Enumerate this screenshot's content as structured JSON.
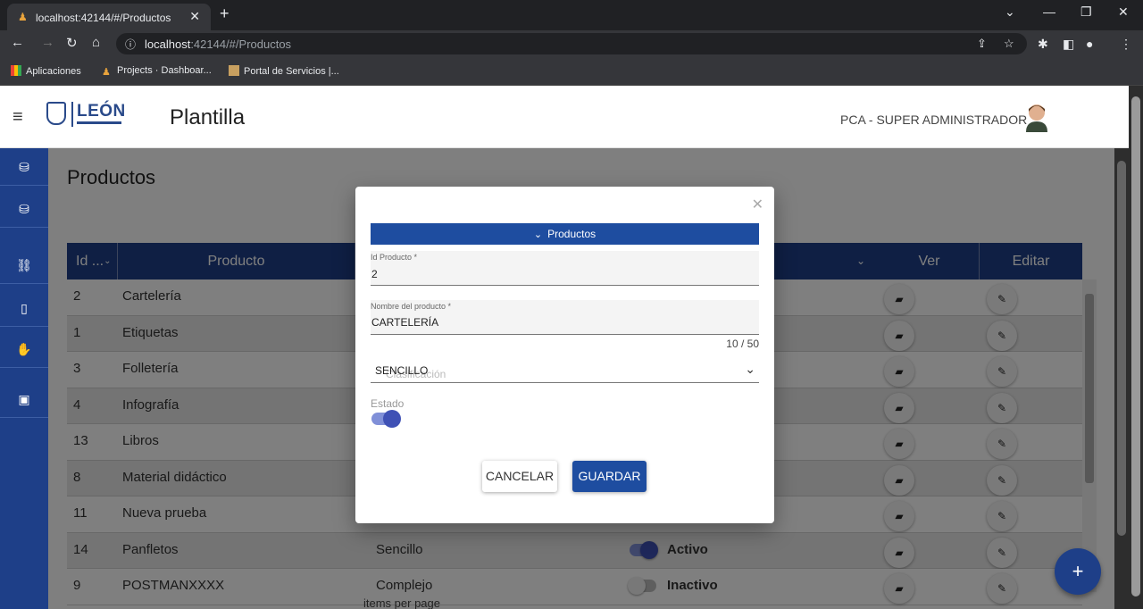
{
  "browser": {
    "tab_title": "localhost:42144/#/Productos",
    "url_host": "localhost",
    "url_rest": ":42144/#/Productos",
    "bookmarks": [
      "Aplicaciones",
      "Projects · Dashboar...",
      "Portal de Servicios |..."
    ]
  },
  "header": {
    "logo_text": "LEÓN",
    "app_title": "Plantilla",
    "user_label": "PCA - SUPER ADMINISTRADOR"
  },
  "sidebar": {
    "items": [
      {
        "icon": "database-icon"
      },
      {
        "icon": "database-icon"
      },
      {
        "icon": "sitemap-icon"
      },
      {
        "icon": "file-icon"
      },
      {
        "icon": "handshake-icon"
      },
      {
        "icon": "image-icon"
      }
    ]
  },
  "page": {
    "title": "Productos"
  },
  "table": {
    "columns": [
      "Id ...",
      "Producto",
      "Ver",
      "Editar"
    ],
    "rows": [
      {
        "id": "2",
        "producto": "Cartelería",
        "clasificacion": "",
        "estado": "",
        "active": null
      },
      {
        "id": "1",
        "producto": "Etiquetas",
        "clasificacion": "",
        "estado": "",
        "active": null
      },
      {
        "id": "3",
        "producto": "Folletería",
        "clasificacion": "",
        "estado": "",
        "active": null
      },
      {
        "id": "4",
        "producto": "Infografía",
        "clasificacion": "",
        "estado": "",
        "active": null
      },
      {
        "id": "13",
        "producto": "Libros",
        "clasificacion": "",
        "estado": "",
        "active": null
      },
      {
        "id": "8",
        "producto": "Material didáctico",
        "clasificacion": "",
        "estado": "",
        "active": null
      },
      {
        "id": "11",
        "producto": "Nueva prueba",
        "clasificacion": "",
        "estado": "",
        "active": null
      },
      {
        "id": "14",
        "producto": "Panfletos",
        "clasificacion": "Sencillo",
        "estado": "Activo",
        "active": true
      },
      {
        "id": "9",
        "producto": "POSTMANXXXX",
        "clasificacion": "Complejo",
        "estado": "Inactivo",
        "active": false
      }
    ]
  },
  "paginator": {
    "label": "items per page"
  },
  "dialog": {
    "header": "Productos",
    "id_label": "Id Producto *",
    "id_value": "2",
    "name_label": "Nombre del producto *",
    "name_value": "CARTELERÍA",
    "name_hint": "10 / 50",
    "clasificacion_placeholder": "Clasificación",
    "clasificacion_value": "SENCILLO",
    "estado_label": "Estado",
    "estado_on": true,
    "cancel_label": "CANCELAR",
    "save_label": "GUARDAR"
  },
  "colors": {
    "primary": "#1e3f88",
    "accent": "#3f51b5"
  }
}
